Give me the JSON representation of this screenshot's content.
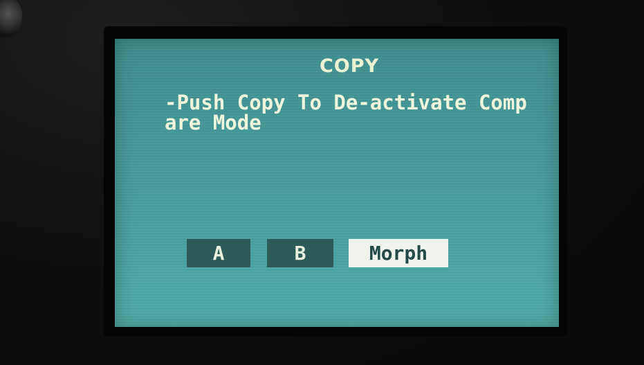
{
  "screen": {
    "title": "COPY",
    "message": "-Push Copy To De-activate Compare Mode"
  },
  "buttons": {
    "a_label": "A",
    "b_label": "B",
    "morph_label": "Morph"
  },
  "colors": {
    "screen_bg": "#469a99",
    "text": "#eef5dd",
    "button_dark": "#2c5b58",
    "button_selected": "#f0f3ec"
  }
}
